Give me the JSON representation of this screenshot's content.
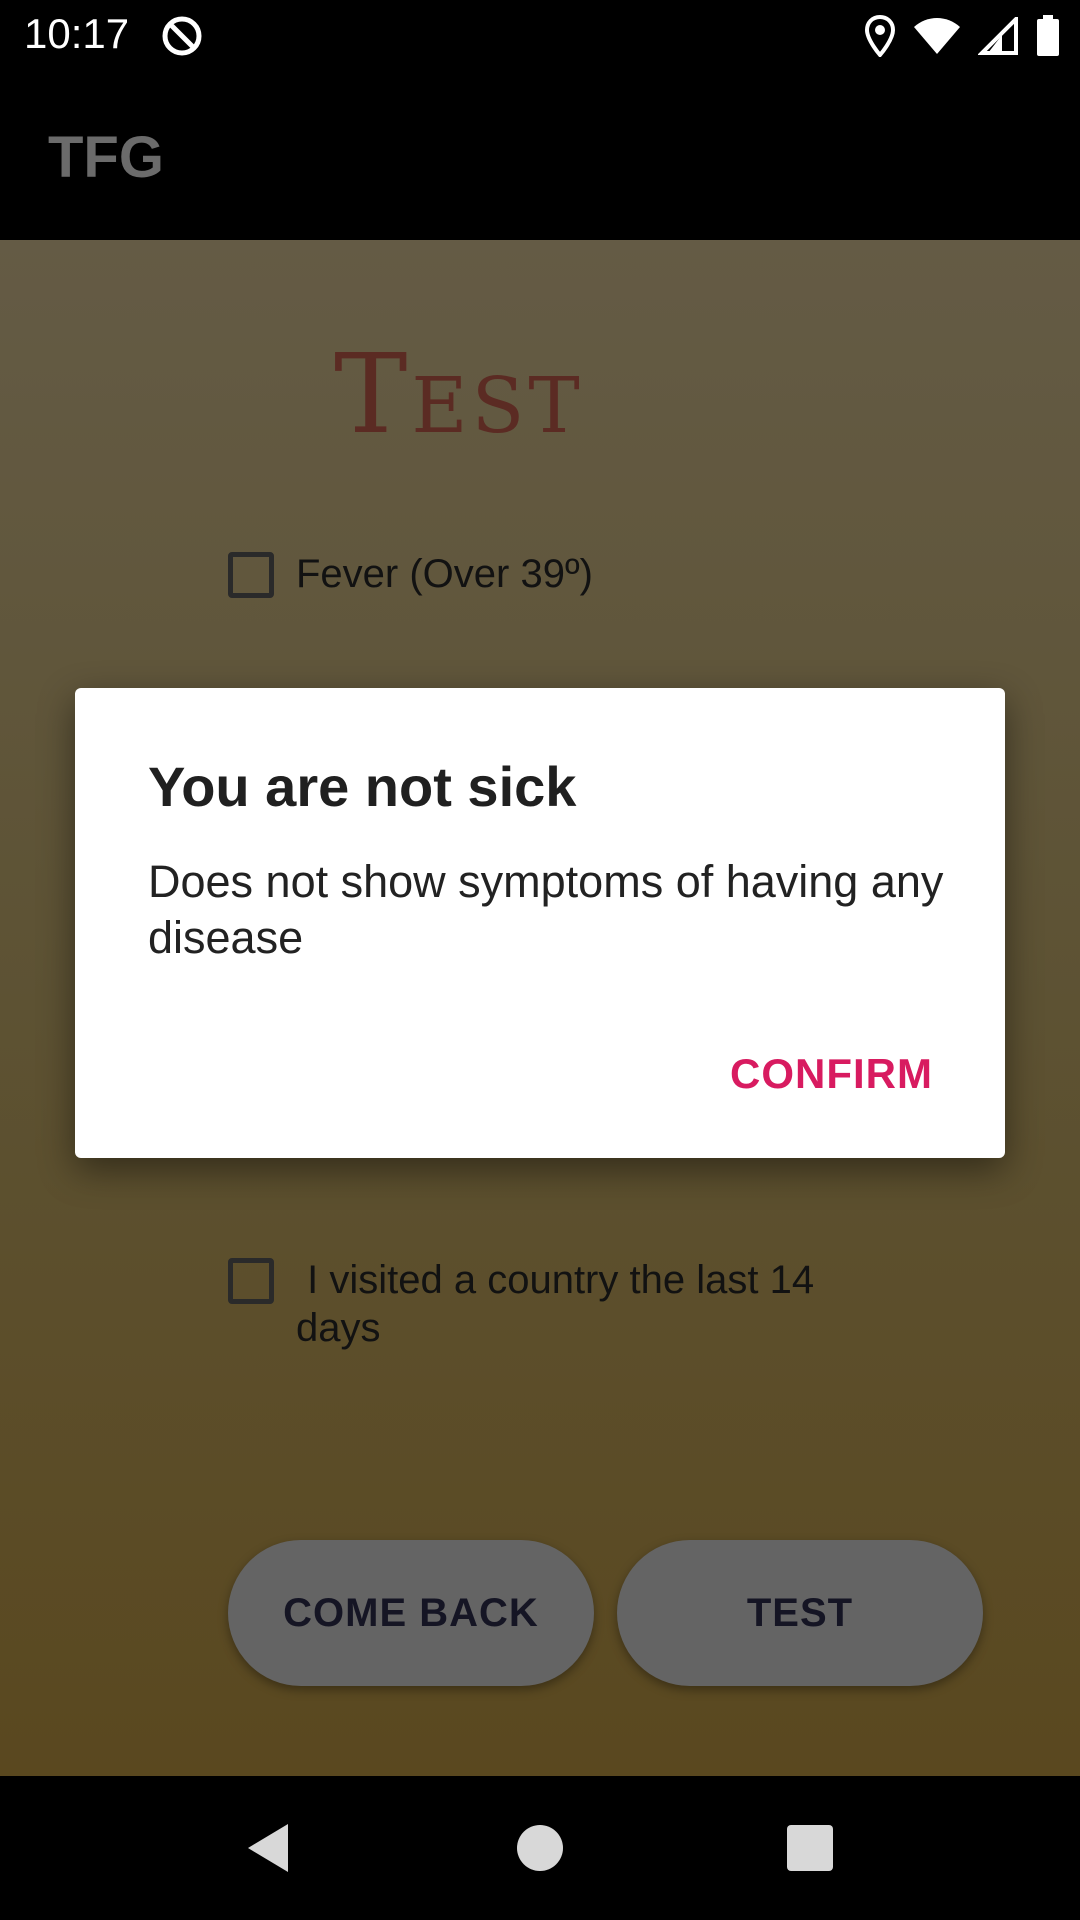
{
  "status_bar": {
    "time": "10:17",
    "icons": [
      "do-not-disturb-icon",
      "location-icon",
      "wifi-icon",
      "signal-icon",
      "battery-icon"
    ]
  },
  "app_bar": {
    "title": "TFG"
  },
  "main": {
    "heading": "Test",
    "checkboxes": [
      {
        "label": "Fever (Over 39º)",
        "checked": false
      },
      {
        "label": " I visited a country the last 14 days",
        "checked": false
      }
    ],
    "buttons": {
      "back": "COME BACK",
      "test": "TEST"
    }
  },
  "dialog": {
    "title": "You are not sick",
    "message": "Does not show symptoms of having any disease",
    "confirm": "CONFIRM"
  },
  "nav_bar": {
    "icons": [
      "back-icon",
      "home-icon",
      "recents-icon"
    ]
  },
  "colors": {
    "accent": "#d81b60",
    "heading": "#5b2b23",
    "button": "#646464"
  }
}
